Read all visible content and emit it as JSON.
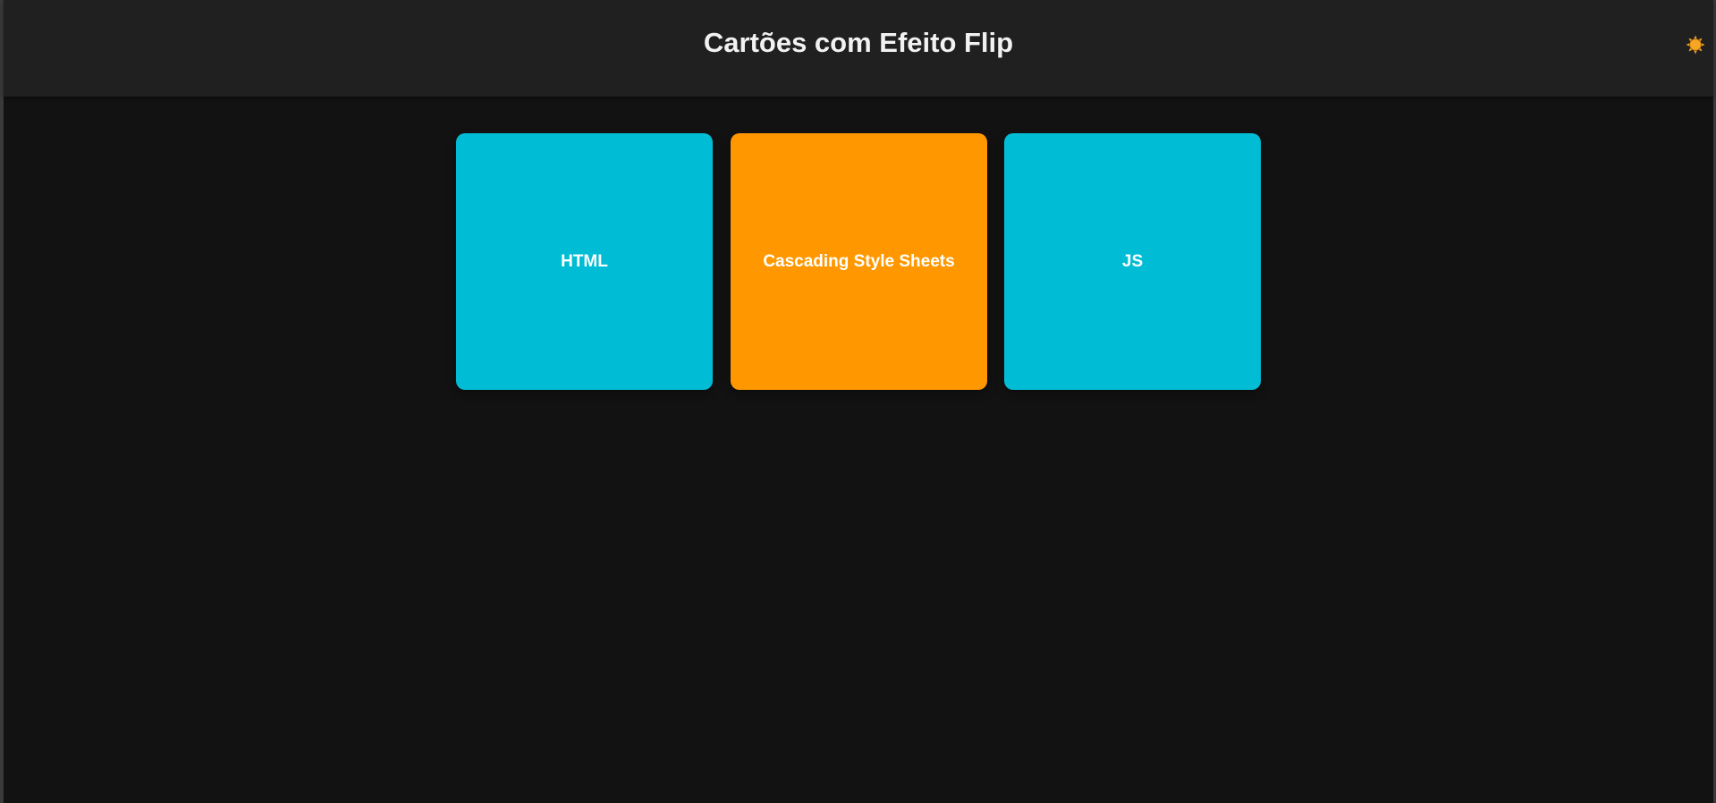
{
  "header": {
    "title": "Cartões com Efeito Flip",
    "theme_toggle_icon": "sun-icon"
  },
  "colors": {
    "page_background": "#121212",
    "header_background": "#202020",
    "title_text": "#f2f2f2",
    "card_default": "#00bcd4",
    "card_active": "#ff9800",
    "card_text": "#ffffff",
    "sun_icon": "#f5a623"
  },
  "cards": [
    {
      "label": "HTML",
      "color": "#00bcd4",
      "state": "front"
    },
    {
      "label": "Cascading Style Sheets",
      "color": "#ff9800",
      "state": "flipped"
    },
    {
      "label": "JS",
      "color": "#00bcd4",
      "state": "front"
    }
  ]
}
